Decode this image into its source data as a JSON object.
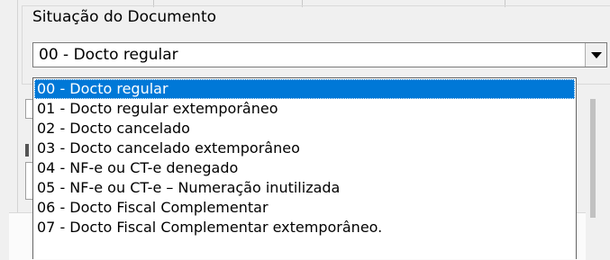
{
  "group": {
    "title": "Situação do Documento"
  },
  "combo": {
    "value": "00 - Docto regular"
  },
  "dropdown": {
    "items": [
      {
        "label": "00 - Docto regular"
      },
      {
        "label": "01 - Docto regular extemporâneo"
      },
      {
        "label": "02 - Docto cancelado"
      },
      {
        "label": "03 - Docto cancelado extemporâneo"
      },
      {
        "label": "04 - NF-e ou CT-e denegado"
      },
      {
        "label": "05 - NF-e ou CT-e – Numeração inutilizada"
      },
      {
        "label": "06 - Docto Fiscal Complementar"
      },
      {
        "label": "07 - Docto Fiscal Complementar extemporâneo."
      }
    ],
    "selected_index": 0
  },
  "icons": {
    "dropdown_arrow": "chevron-down-icon"
  },
  "colors": {
    "selection": "#0078d7",
    "window": "#f0f0f0",
    "field": "#ffffff"
  }
}
